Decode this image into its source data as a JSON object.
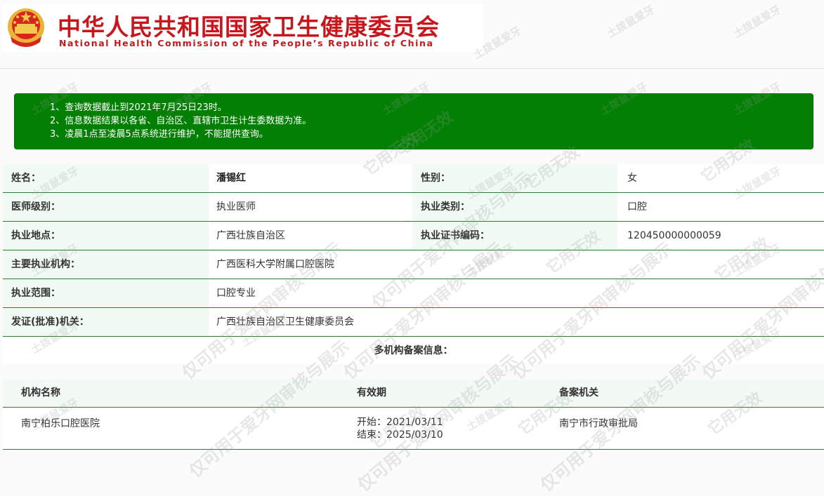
{
  "header": {
    "title_cn": "中华人民共和国国家卫生健康委员会",
    "title_en": "National Health Commission of the People’s Republic of China"
  },
  "notice": {
    "lines": [
      "1、查询数据截止到2021年7月25日23时。",
      "2、信息数据结果以各省、自治区、直辖市卫生计生委数据为准。",
      "3、凌晨1点至凌晨5点系统进行维护，不能提供查询。"
    ]
  },
  "info": {
    "name_label": "姓名：",
    "name_value": "潘锡红",
    "gender_label": "性别：",
    "gender_value": "女",
    "level_label": "医师级别：",
    "level_value": "执业医师",
    "category_label": "执业类别：",
    "category_value": "口腔",
    "place_label": "执业地点：",
    "place_value": "广西壮族自治区",
    "cert_label": "执业证书编码：",
    "cert_value": "120450000000059",
    "org_label": "主要执业机构：",
    "org_value": "广西医科大学附属口腔医院",
    "scope_label": "执业范围：",
    "scope_value": "口腔专业",
    "issuer_label": "发证(批准)机关：",
    "issuer_value": "广西壮族自治区卫生健康委员会"
  },
  "multi": {
    "title": "多机构备案信息：",
    "headers": {
      "org": "机构名称",
      "valid": "有效期",
      "authority": "备案机关"
    },
    "rows": [
      {
        "org": "南宁柏乐口腔医院",
        "start": "开始：2021/03/11",
        "end": "结束：2025/03/10",
        "authority": "南宁市行政审批局"
      }
    ]
  },
  "watermark": {
    "small": "土拨鼠爱牙",
    "medium": "它用无效",
    "large": "仅可用于爱牙网审核与展示"
  }
}
